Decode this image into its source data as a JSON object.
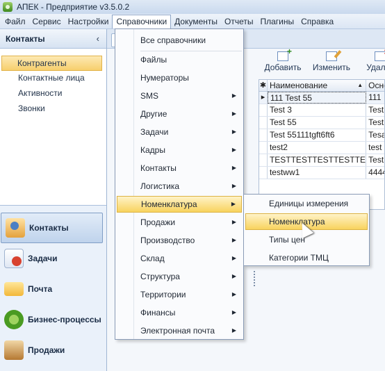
{
  "window": {
    "title": "АПЕК - Предприятие v3.5.0.2"
  },
  "menubar": [
    "Файл",
    "Сервис",
    "Настройки",
    "Справочники",
    "Документы",
    "Отчеты",
    "Плагины",
    "Справка"
  ],
  "left_panel": {
    "title": "Контакты",
    "nav_items": [
      "Контрагенты",
      "Контактные лица",
      "Активности",
      "Звонки"
    ],
    "modules": [
      "Контакты",
      "Задачи",
      "Почта",
      "Бизнес-процессы",
      "Продажи"
    ]
  },
  "toolbar": {
    "add": "Добавить",
    "edit": "Изменить",
    "delete": "Удалит"
  },
  "grid": {
    "columns": [
      "Наименование",
      "Осно"
    ],
    "rows": [
      {
        "name": "111 Test 55",
        "b": "111"
      },
      {
        "name": "Test 3",
        "b": "Test"
      },
      {
        "name": "Test 55",
        "b": "Test"
      },
      {
        "name": "Test 55111tgft6ft6",
        "b": "Tesa"
      },
      {
        "name": "test2",
        "b": "test"
      },
      {
        "name": "TESTTESTTESTTESTTEST",
        "b": "Test"
      },
      {
        "name": "testww1",
        "b": "4444"
      }
    ]
  },
  "dropdown": {
    "items": [
      "Все справочники",
      "Файлы",
      "Нумераторы",
      "SMS",
      "Другие",
      "Задачи",
      "Кадры",
      "Контакты",
      "Логистика",
      "Номенклатура",
      "Продажи",
      "Производство",
      "Склад",
      "Структура",
      "Территории",
      "Финансы",
      "Электронная почта"
    ]
  },
  "submenu": {
    "items": [
      "Единицы измерения",
      "Номенклатура",
      "Типы цен",
      "Категории ТМЦ"
    ]
  }
}
